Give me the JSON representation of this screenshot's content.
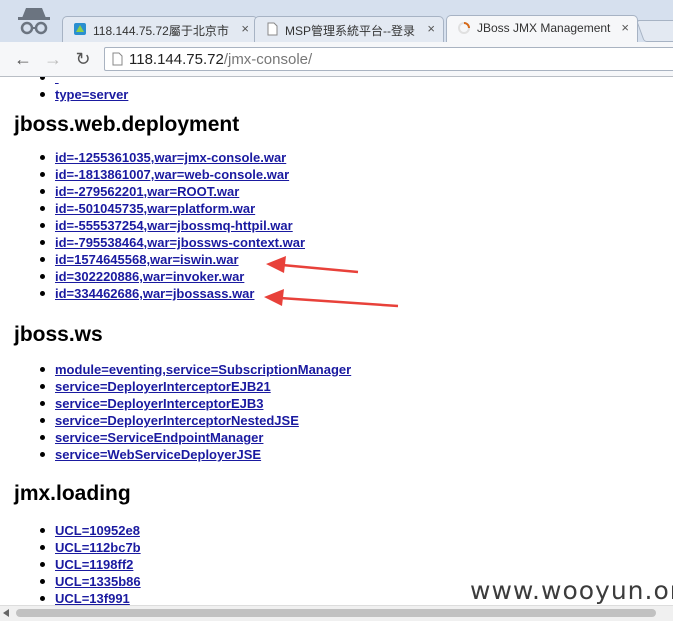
{
  "browser": {
    "tabs": [
      {
        "title": "118.144.75.72屬于北京市"
      },
      {
        "title": "MSP管理系統平台--登录"
      },
      {
        "title": "JBoss JMX Management"
      }
    ],
    "close_glyph": "×",
    "url_host": "118.144.75.72",
    "url_path": "/jmx-console/",
    "back_glyph": "←",
    "forward_glyph": "→",
    "reload_glyph": "↻"
  },
  "page": {
    "top_items": [
      "type=server"
    ],
    "sections": [
      {
        "heading": "jboss.web.deployment",
        "items": [
          "id=-1255361035,war=jmx-console.war",
          "id=-1813861007,war=web-console.war",
          "id=-279562201,war=ROOT.war",
          "id=-501045735,war=platform.war",
          "id=-555537254,war=jbossmq-httpil.war",
          "id=-795538464,war=jbossws-context.war",
          "id=1574645568,war=iswin.war",
          "id=302220886,war=invoker.war",
          "id=334462686,war=jbossass.war"
        ]
      },
      {
        "heading": "jboss.ws",
        "items": [
          "module=eventing,service=SubscriptionManager",
          "service=DeployerInterceptorEJB21",
          "service=DeployerInterceptorEJB3",
          "service=DeployerInterceptorNestedJSE",
          "service=ServiceEndpointManager",
          "service=WebServiceDeployerJSE"
        ]
      },
      {
        "heading": "jmx.loading",
        "items": [
          "UCL=10952e8",
          "UCL=112bc7b",
          "UCL=1198ff2",
          "UCL=1335b86",
          "UCL=13f991"
        ]
      }
    ],
    "annotation_color": "#e8413a"
  },
  "watermark": "www.wooyun.org"
}
